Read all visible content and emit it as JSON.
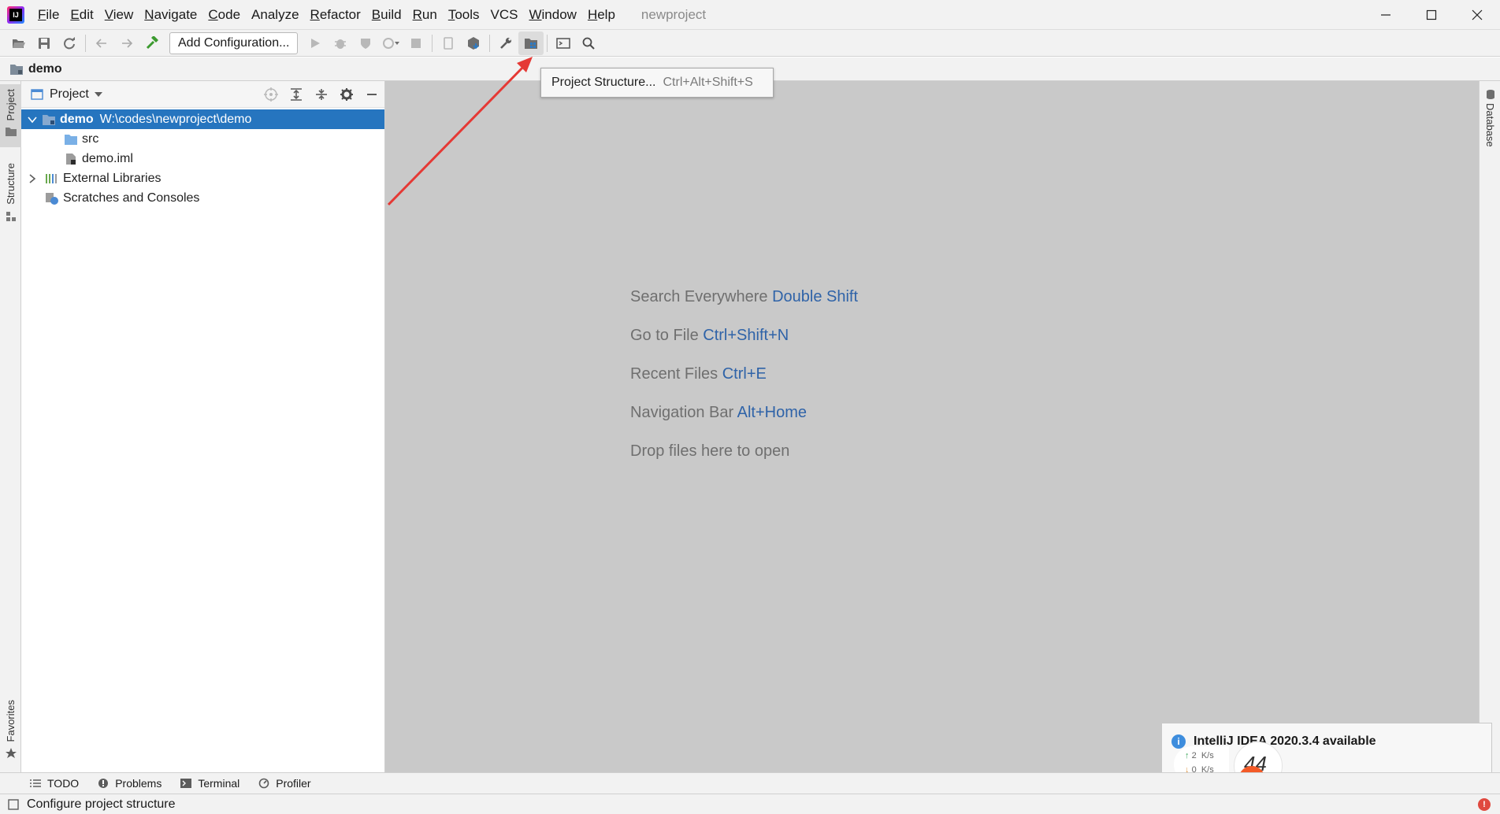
{
  "menu": {
    "items": [
      {
        "mnemonic": "F",
        "rest": "ile"
      },
      {
        "mnemonic": "E",
        "rest": "dit"
      },
      {
        "mnemonic": "V",
        "rest": "iew"
      },
      {
        "mnemonic": "N",
        "rest": "avigate"
      },
      {
        "mnemonic": "C",
        "rest": "ode"
      },
      {
        "mnemonic": "",
        "rest": "Analyze"
      },
      {
        "mnemonic": "R",
        "rest": "efactor"
      },
      {
        "mnemonic": "B",
        "rest": "uild"
      },
      {
        "mnemonic": "R",
        "rest": "un"
      },
      {
        "mnemonic": "T",
        "rest": "ools"
      },
      {
        "mnemonic": "",
        "rest": "VCS"
      },
      {
        "mnemonic": "W",
        "rest": "indow"
      },
      {
        "mnemonic": "H",
        "rest": "elp"
      }
    ],
    "window_title": "newproject"
  },
  "toolbar": {
    "add_config_label": "Add Configuration...",
    "tooltip_label": "Project Structure...",
    "tooltip_shortcut": "Ctrl+Alt+Shift+S"
  },
  "navbar": {
    "crumb": "demo"
  },
  "stripes": {
    "project": "Project",
    "structure": "Structure",
    "favorites": "Favorites",
    "database": "Database"
  },
  "project_panel": {
    "title": "Project",
    "tree": {
      "root_name": "demo",
      "root_path": "W:\\codes\\newproject\\demo",
      "src": "src",
      "iml": "demo.iml",
      "ext_libs": "External Libraries",
      "scratches": "Scratches and Consoles"
    }
  },
  "editor": {
    "hints": [
      {
        "text": "Search Everywhere",
        "key": "Double Shift"
      },
      {
        "text": "Go to File",
        "key": "Ctrl+Shift+N"
      },
      {
        "text": "Recent Files",
        "key": "Ctrl+E"
      },
      {
        "text": "Navigation Bar",
        "key": "Alt+Home"
      },
      {
        "text": "Drop files here to open",
        "key": ""
      }
    ]
  },
  "notification": {
    "title": "IntelliJ IDEA 2020.3.4 available",
    "net_up": "2",
    "net_down": "0",
    "net_unit": "K/s",
    "ime_number": "44"
  },
  "bottom_tools": {
    "todo": "TODO",
    "problems": "Problems",
    "terminal": "Terminal",
    "profiler": "Profiler"
  },
  "status": {
    "message": "Configure project structure"
  },
  "colors": {
    "selection": "#2675bf",
    "editor_bg": "#c9c9c9",
    "accent_key": "#2f63a8",
    "arrow": "#e53935"
  }
}
